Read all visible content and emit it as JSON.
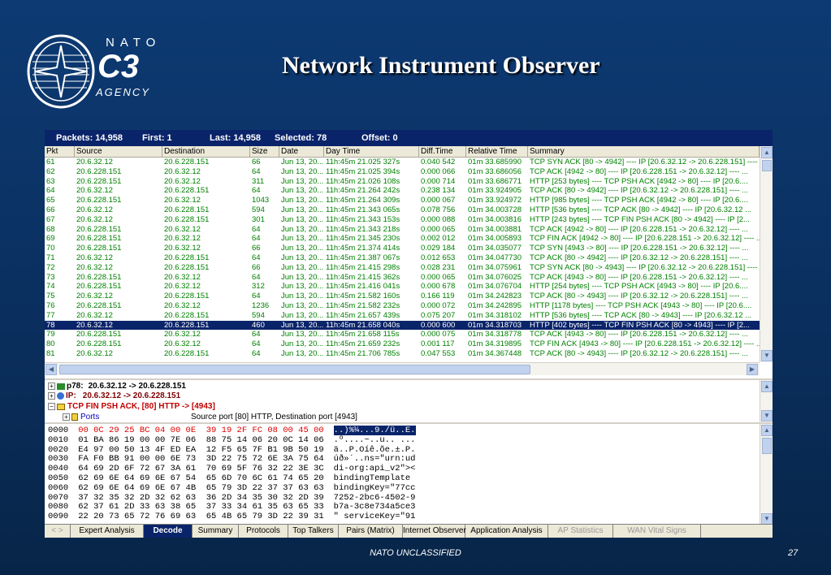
{
  "slide": {
    "title": "Network Instrument Observer",
    "footer": "NATO UNCLASSIFIED",
    "page_number": "27"
  },
  "logo": {
    "nato": "NATO",
    "c3": "C3",
    "agency": "AGENCY"
  },
  "status": {
    "packets": "Packets: 14,958",
    "first": "First: 1",
    "last": "Last: 14,958",
    "selected": "Selected: 78",
    "offset": "Offset: 0"
  },
  "columns": [
    "Pkt",
    "Source",
    "Destination",
    "Size",
    "Date",
    "Day Time",
    "Diff.Time",
    "Relative Time",
    "Summary"
  ],
  "packets": [
    [
      "61",
      "20.6.32.12",
      "20.6.228.151",
      "66",
      "Jun 13, 20...",
      "11h:45m 21.025 327s",
      "0.040 542",
      "01m 33.685990",
      "TCP SYN ACK [80 -> 4942]  ----  IP [20.6.32.12 -> 20.6.228.151] ----  ..."
    ],
    [
      "62",
      "20.6.228.151",
      "20.6.32.12",
      "64",
      "Jun 13, 20...",
      "11h:45m 21.025 394s",
      "0.000 066",
      "01m 33.686056",
      "TCP ACK [4942 -> 80]  ----  IP [20.6.228.151 -> 20.6.32.12]  ----  ..."
    ],
    [
      "63",
      "20.6.228.151",
      "20.6.32.12",
      "311",
      "Jun 13, 20...",
      "11h:45m 21.026 108s",
      "0.000 714",
      "01m 33.686771",
      "HTTP [253 bytes]  ----  TCP PSH ACK [4942 -> 80]  ----  IP [20.6...."
    ],
    [
      "64",
      "20.6.32.12",
      "20.6.228.151",
      "64",
      "Jun 13, 20...",
      "11h:45m 21.264 242s",
      "0.238 134",
      "01m 33.924905",
      "TCP ACK [80 -> 4942]  ----  IP [20.6.32.12 -> 20.6.228.151]  ----  ..."
    ],
    [
      "65",
      "20.6.228.151",
      "20.6.32.12",
      "1043",
      "Jun 13, 20...",
      "11h:45m 21.264 309s",
      "0.000 067",
      "01m 33.924972",
      "HTTP [985 bytes]  ----  TCP PSH ACK [4942 -> 80]  ----  IP [20.6...."
    ],
    [
      "66",
      "20.6.32.12",
      "20.6.228.151",
      "594",
      "Jun 13, 20...",
      "11h:45m 21.343 065s",
      "0.078 756",
      "01m 34.003728",
      "HTTP [536 bytes]  ----  TCP ACK [80 -> 4942]  ----  IP [20.6.32.12 ..."
    ],
    [
      "67",
      "20.6.32.12",
      "20.6.228.151",
      "301",
      "Jun 13, 20...",
      "11h:45m 21.343 153s",
      "0.000 088",
      "01m 34.003816",
      "HTTP [243 bytes]  ----  TCP FIN PSH ACK [80 -> 4942]  ----  IP [2..."
    ],
    [
      "68",
      "20.6.228.151",
      "20.6.32.12",
      "64",
      "Jun 13, 20...",
      "11h:45m 21.343 218s",
      "0.000 065",
      "01m 34.003881",
      "TCP ACK [4942 -> 80]  ----  IP [20.6.228.151 -> 20.6.32.12]  ----  ..."
    ],
    [
      "69",
      "20.6.228.151",
      "20.6.32.12",
      "64",
      "Jun 13, 20...",
      "11h:45m 21.345 230s",
      "0.002 012",
      "01m 34.005893",
      "TCP FIN ACK [4942 -> 80]  ----  IP [20.6.228.151 -> 20.6.32.12]  ----  ..."
    ],
    [
      "70",
      "20.6.228.151",
      "20.6.32.12",
      "66",
      "Jun 13, 20...",
      "11h:45m 21.374 414s",
      "0.029 184",
      "01m 34.035077",
      "TCP SYN [4943 -> 80]  ----  IP [20.6.228.151 -> 20.6.32.12]  ----  ..."
    ],
    [
      "71",
      "20.6.32.12",
      "20.6.228.151",
      "64",
      "Jun 13, 20...",
      "11h:45m 21.387 067s",
      "0.012 653",
      "01m 34.047730",
      "TCP ACK [80 -> 4942]  ----  IP [20.6.32.12 -> 20.6.228.151]  ----  ..."
    ],
    [
      "72",
      "20.6.32.12",
      "20.6.228.151",
      "66",
      "Jun 13, 20...",
      "11h:45m 21.415 298s",
      "0.028 231",
      "01m 34.075961",
      "TCP SYN ACK [80 -> 4943]  ----  IP [20.6.32.12 -> 20.6.228.151] ----  ..."
    ],
    [
      "73",
      "20.6.228.151",
      "20.6.32.12",
      "64",
      "Jun 13, 20...",
      "11h:45m 21.415 362s",
      "0.000 065",
      "01m 34.076025",
      "TCP ACK [4943 -> 80]  ----  IP [20.6.228.151 -> 20.6.32.12]  ----  ..."
    ],
    [
      "74",
      "20.6.228.151",
      "20.6.32.12",
      "312",
      "Jun 13, 20...",
      "11h:45m 21.416 041s",
      "0.000 678",
      "01m 34.076704",
      "HTTP [254 bytes]  ----  TCP PSH ACK [4943 -> 80]  ----  IP [20.6...."
    ],
    [
      "75",
      "20.6.32.12",
      "20.6.228.151",
      "64",
      "Jun 13, 20...",
      "11h:45m 21.582 160s",
      "0.166 119",
      "01m 34.242823",
      "TCP ACK [80 -> 4943]  ----  IP [20.6.32.12 -> 20.6.228.151]  ----  ..."
    ],
    [
      "76",
      "20.6.228.151",
      "20.6.32.12",
      "1236",
      "Jun 13, 20...",
      "11h:45m 21.582 232s",
      "0.000 072",
      "01m 34.242895",
      "HTTP [1178 bytes]  ----  TCP PSH ACK [4943 -> 80]  ----  IP [20.6...."
    ],
    [
      "77",
      "20.6.32.12",
      "20.6.228.151",
      "594",
      "Jun 13, 20...",
      "11h:45m 21.657 439s",
      "0.075 207",
      "01m 34.318102",
      "HTTP [536 bytes]  ----  TCP ACK [80 -> 4943]  ----  IP [20.6.32.12 ..."
    ],
    [
      "78",
      "20.6.32.12",
      "20.6.228.151",
      "460",
      "Jun 13, 20...",
      "11h:45m 21.658 040s",
      "0.000 600",
      "01m 34.318703",
      "HTTP [402 bytes]  ----  TCP FIN PSH ACK [80 -> 4943]  ----  IP [2..."
    ],
    [
      "79",
      "20.6.228.151",
      "20.6.32.12",
      "64",
      "Jun 13, 20...",
      "11h:45m 21.658 115s",
      "0.000 075",
      "01m 34.318778",
      "TCP ACK [4943 -> 80]  ----  IP [20.6.228.151 -> 20.6.32.12]  ----  ..."
    ],
    [
      "80",
      "20.6.228.151",
      "20.6.32.12",
      "64",
      "Jun 13, 20...",
      "11h:45m 21.659 232s",
      "0.001 117",
      "01m 34.319895",
      "TCP FIN ACK [4943 -> 80]  ----  IP [20.6.228.151 -> 20.6.32.12]  ----  ..."
    ],
    [
      "81",
      "20.6.32.12",
      "20.6.228.151",
      "64",
      "Jun 13, 20...",
      "11h:45m 21.706 785s",
      "0.047 553",
      "01m 34.367448",
      "TCP ACK [80 -> 4943]  ----  IP [20.6.32.12 -> 20.6.228.151]  ----  ..."
    ]
  ],
  "selected_packet": "78",
  "decode": {
    "line1_label": "p78:",
    "line1_value": "20.6.32.12 -> 20.6.228.151",
    "line2_label": "IP:",
    "line2_value": "20.6.32.12 -> 20.6.228.151",
    "line3": "TCP  FIN PSH ACK,   [80] HTTP -> [4943]",
    "line4_label": "Ports",
    "line4_value": "Source port [80] HTTP, Destination port [4943]"
  },
  "hex_lines": [
    {
      "off": "0000",
      "hex": "00 0C 29 25 BC 04 00 0E  39 19 2F FC 08 00 45 00",
      "ascii": "..)%¼...9./ü..E."
    },
    {
      "off": "0010",
      "hex": "01 BA 86 19 00 00 7E 06  88 75 14 06 20 0C 14 06",
      "ascii": ".º....~..u.. ..."
    },
    {
      "off": "0020",
      "hex": "E4 97 00 50 13 4F ED EA  12 F5 65 7F B1 9B 50 19",
      "ascii": "ä..P.Oíê.õe.±.P."
    },
    {
      "off": "0030",
      "hex": "FA F0 BB 91 00 00 6E 73  3D 22 75 72 6E 3A 75 64",
      "ascii": "úð»´..ns=\"urn:ud"
    },
    {
      "off": "0040",
      "hex": "64 69 2D 6F 72 67 3A 61  70 69 5F 76 32 22 3E 3C",
      "ascii": "di-org:api_v2\"><"
    },
    {
      "off": "0050",
      "hex": "62 69 6E 64 69 6E 67 54  65 6D 70 6C 61 74 65 20",
      "ascii": "bindingTemplate "
    },
    {
      "off": "0060",
      "hex": "62 69 6E 64 69 6E 67 4B  65 79 3D 22 37 37 63 63",
      "ascii": "bindingKey=\"77cc"
    },
    {
      "off": "0070",
      "hex": "37 32 35 32 2D 32 62 63  36 2D 34 35 30 32 2D 39",
      "ascii": "7252-2bc6-4502-9"
    },
    {
      "off": "0080",
      "hex": "62 37 61 2D 33 63 38 65  37 33 34 61 35 63 65 33",
      "ascii": "b7a-3c8e734a5ce3"
    },
    {
      "off": "0090",
      "hex": "22 20 73 65 72 76 69 63  65 4B 65 79 3D 22 39 31",
      "ascii": "\" serviceKey=\"91"
    }
  ],
  "tabs": [
    "Expert Analysis",
    "Decode",
    "Summary",
    "Protocols",
    "Top Talkers",
    "Pairs (Matrix)",
    "Internet Observer",
    "Application Analysis",
    "AP Statistics",
    "WAN Vital Signs"
  ],
  "active_tab": "Decode",
  "disabled_tabs": [
    "AP Statistics",
    "WAN Vital Signs"
  ],
  "colors": {
    "row_text": "#008000",
    "selection": "#0a246a",
    "bg_top": "#0d3a73",
    "hex_highlight": "#e00000"
  }
}
